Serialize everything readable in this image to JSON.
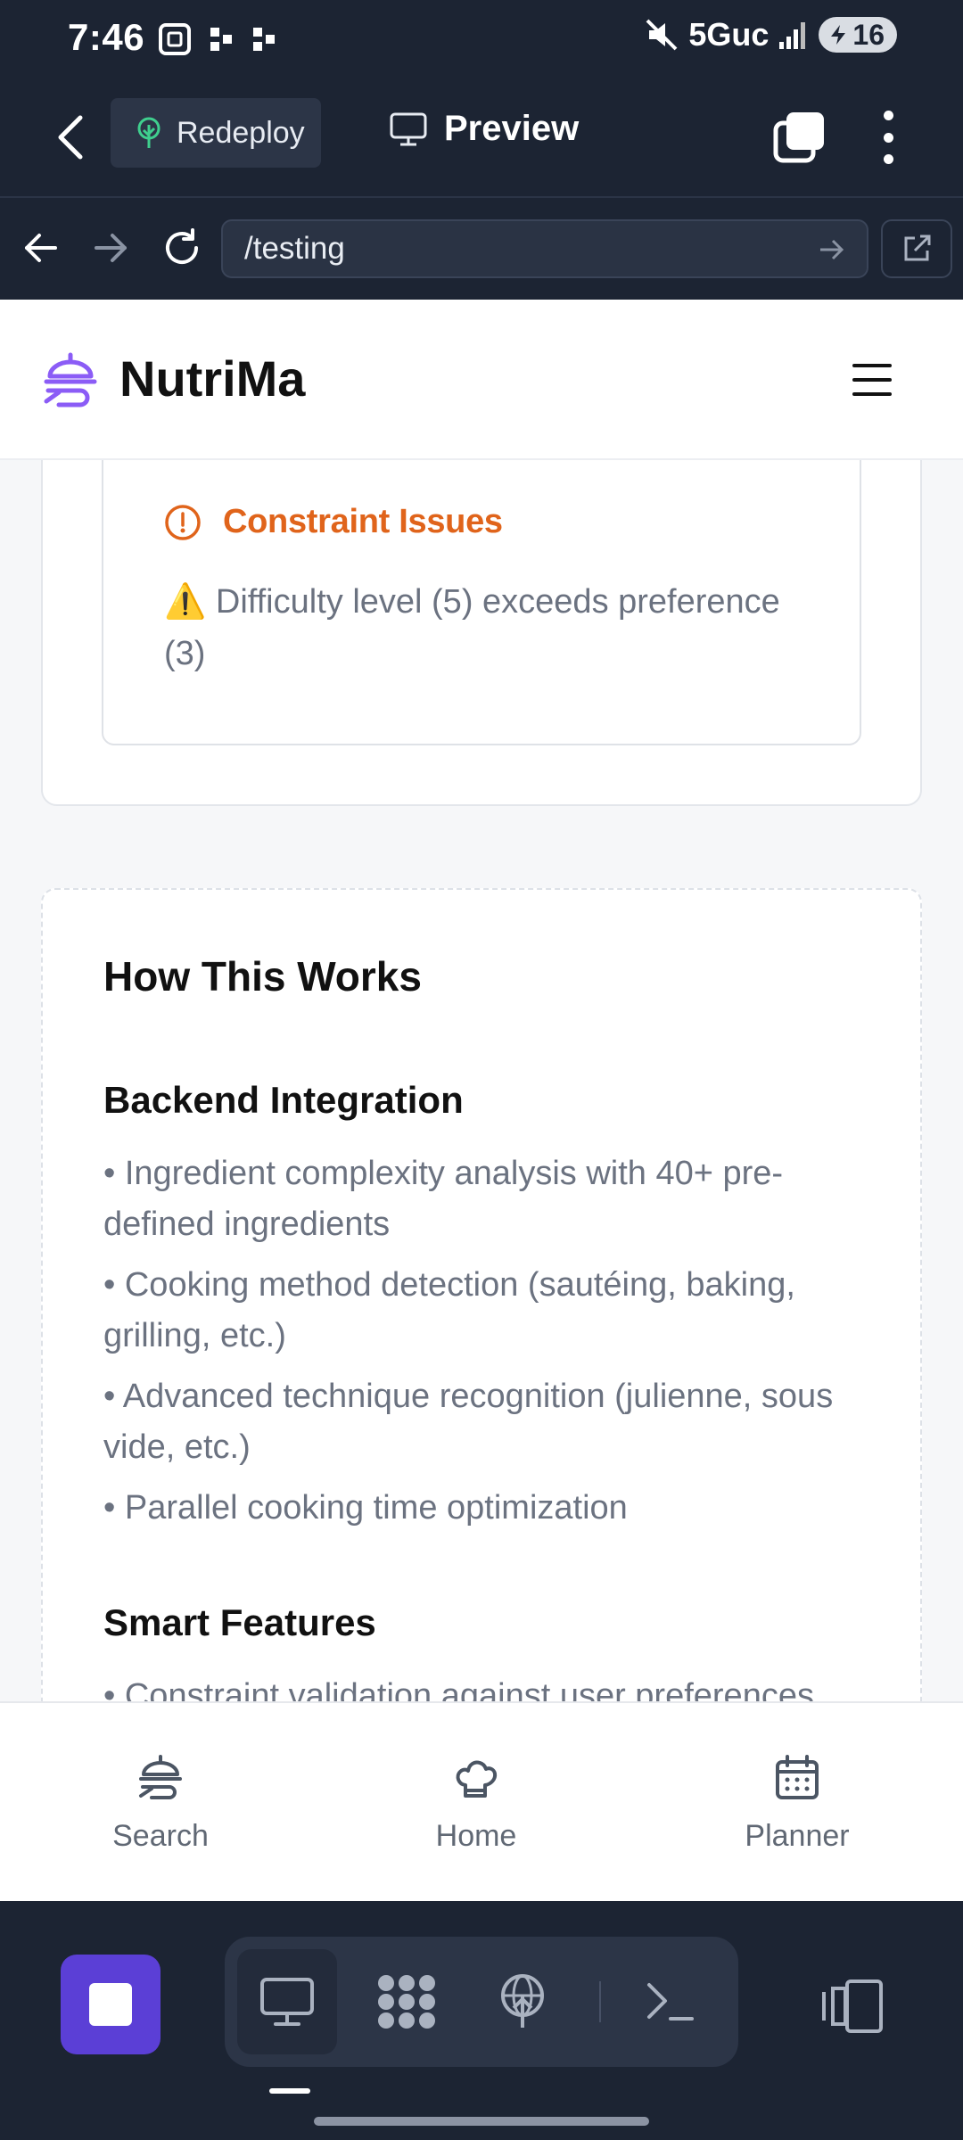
{
  "status_bar": {
    "time": "7:46",
    "network": "5Guc",
    "battery": "16"
  },
  "app_toolbar": {
    "redeploy_label": "Redeploy",
    "preview_label": "Preview"
  },
  "url_bar": {
    "url": "/testing"
  },
  "site": {
    "brand": "NutriMa",
    "constraint": {
      "title": "Constraint Issues",
      "message": "⚠️ Difficulty level (5) exceeds preference (3)"
    },
    "how": {
      "title": "How This Works",
      "backend_title": "Backend Integration",
      "backend_items": [
        "• Ingredient complexity analysis with 40+ pre-defined ingredients",
        "• Cooking method detection (sautéing, baking, grilling, etc.)",
        "• Advanced technique recognition (julienne, sous vide, etc.)",
        "• Parallel cooking time optimization"
      ],
      "smart_title": "Smart Features",
      "smart_items": [
        "• Constraint validation against user preferences"
      ]
    },
    "bottom_nav": {
      "search": "Search",
      "home": "Home",
      "planner": "Planner"
    }
  },
  "colors": {
    "accent_purple": "#5b3fd6",
    "logo_purple": "#8b5cf6",
    "warning_orange": "#e0641b",
    "dark_bg": "#1c2433"
  }
}
